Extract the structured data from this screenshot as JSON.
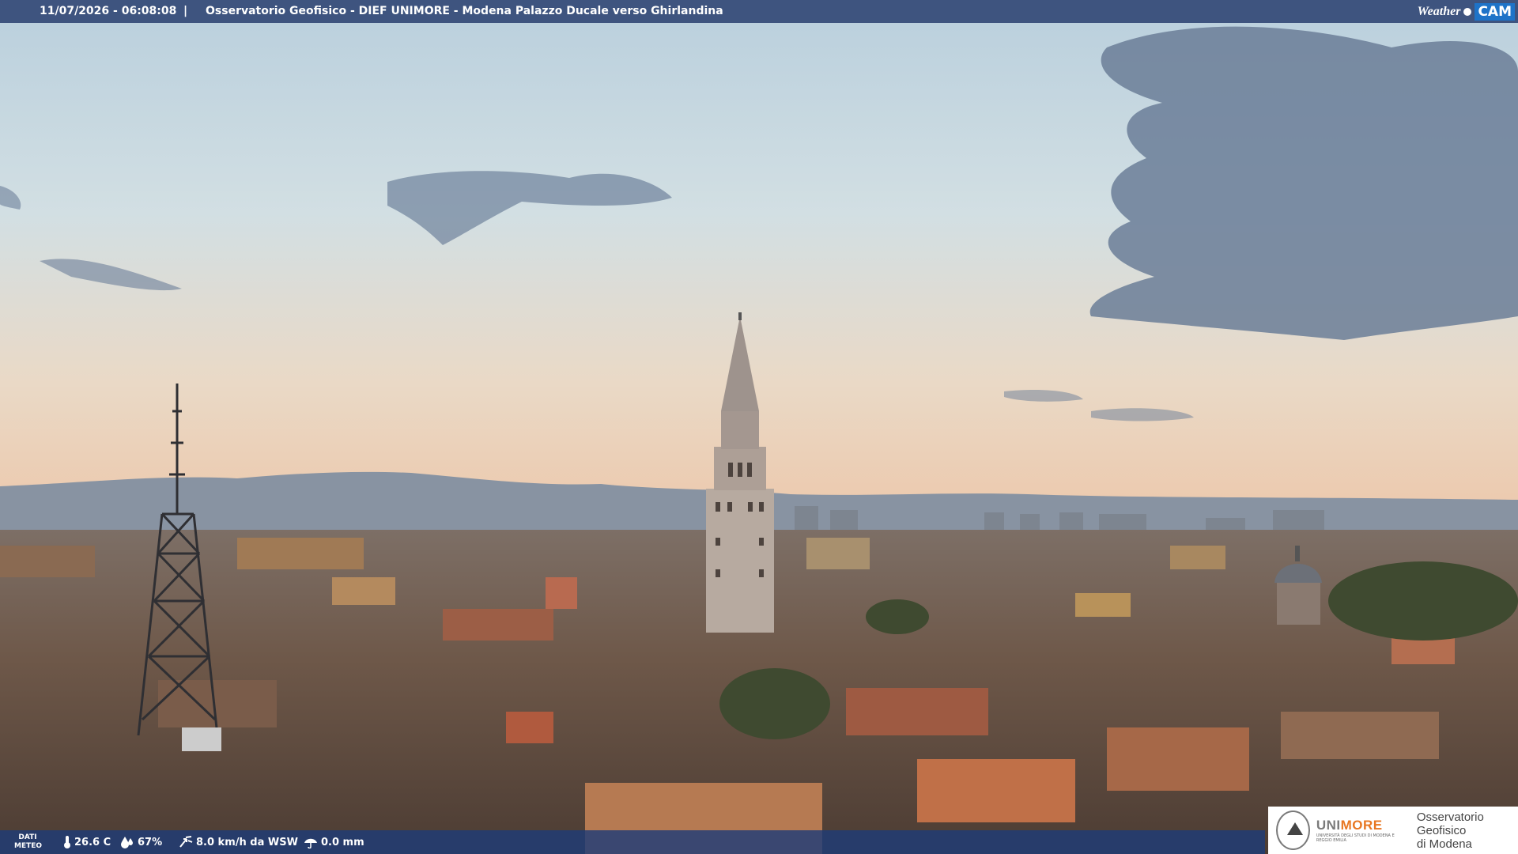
{
  "header": {
    "timestamp": "11/07/2026 - 06:08:08",
    "separator": "|",
    "location": "Osservatorio Geofisico - DIEF UNIMORE - Modena Palazzo Ducale verso Ghirlandina"
  },
  "logo": {
    "weather": "Weather",
    "cam": "CAM"
  },
  "weather_bar": {
    "label_line1": "DATI",
    "label_line2": "METEO",
    "temperature": "26.6 C",
    "humidity": "67%",
    "wind": "8.0 km/h da WSW",
    "rain": "0.0 mm"
  },
  "institution": {
    "brand_a": "UNI",
    "brand_b": "MORE",
    "brand_small": "UNIVERSITÀ DEGLI STUDI DI MODENA E REGGIO EMILIA",
    "name_line1": "Osservatorio Geofisico",
    "name_line2": "di Modena"
  },
  "colors": {
    "bar_blue": "#283e6e",
    "sky_top": "#c9dbe6",
    "sky_bottom": "#e8c5aa",
    "accent_orange": "#e87722"
  }
}
